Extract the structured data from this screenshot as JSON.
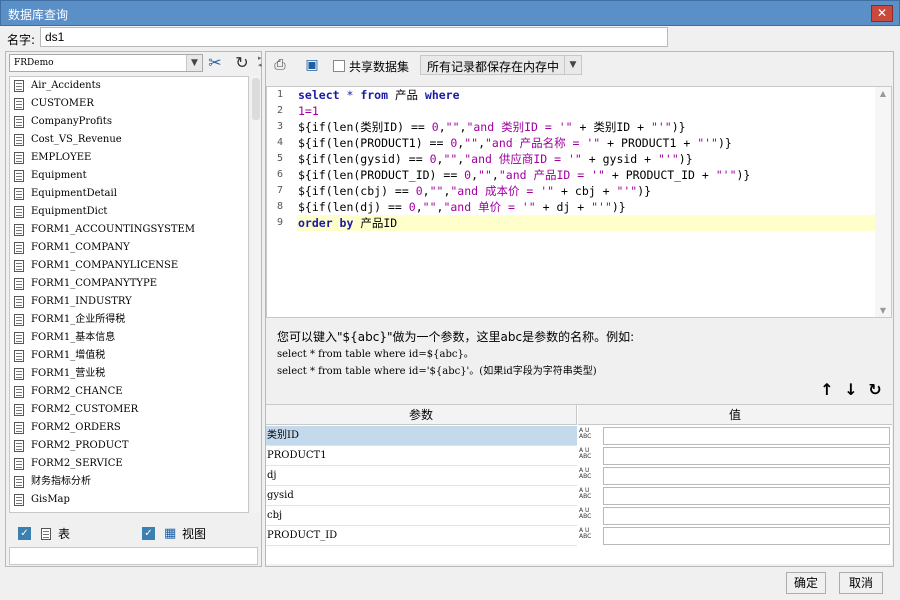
{
  "window": {
    "title": "数据库查询",
    "close_glyph": "✕"
  },
  "name_field": {
    "label": "名字:",
    "value": "ds1"
  },
  "datasource": {
    "selected": "FRDemo",
    "dropdown_glyph": "▼"
  },
  "tables": [
    "Air_Accidents",
    "CUSTOMER",
    "CompanyProfits",
    "Cost_VS_Revenue",
    "EMPLOYEE",
    "Equipment",
    "EquipmentDetail",
    "EquipmentDict",
    "FORM1_ACCOUNTINGSYSTEM",
    "FORM1_COMPANY",
    "FORM1_COMPANYLICENSE",
    "FORM1_COMPANYTYPE",
    "FORM1_INDUSTRY",
    "FORM1_企业所得税",
    "FORM1_基本信息",
    "FORM1_增值税",
    "FORM1_营业税",
    "FORM2_CHANCE",
    "FORM2_CUSTOMER",
    "FORM2_ORDERS",
    "FORM2_PRODUCT",
    "FORM2_SERVICE",
    "财务指标分析",
    "GisMap"
  ],
  "filters": {
    "table_label": "表",
    "view_label": "视图",
    "table_checked": true,
    "view_checked": true
  },
  "toolbar": {
    "share_label": "共享数据集",
    "memory_option": "所有记录都保存在内存中"
  },
  "sql_lines": [
    [
      {
        "t": "select",
        "c": "kw"
      },
      {
        "t": " * ",
        "c": "op"
      },
      {
        "t": "from",
        "c": "kw"
      },
      {
        "t": " 产品 ",
        "c": ""
      },
      {
        "t": "where",
        "c": "kw"
      }
    ],
    [
      {
        "t": "1=1",
        "c": "num"
      }
    ],
    [
      {
        "t": "${if(len(类别ID) == ",
        "c": ""
      },
      {
        "t": "0",
        "c": "num"
      },
      {
        "t": ",",
        "c": ""
      },
      {
        "t": "\"\"",
        "c": "str"
      },
      {
        "t": ",",
        "c": ""
      },
      {
        "t": "\"and 类别ID = '\"",
        "c": "str"
      },
      {
        "t": " + 类别ID + ",
        "c": ""
      },
      {
        "t": "\"'\"",
        "c": "str"
      },
      {
        "t": ")}",
        "c": ""
      }
    ],
    [
      {
        "t": "${if(len(PRODUCT1) == ",
        "c": ""
      },
      {
        "t": "0",
        "c": "num"
      },
      {
        "t": ",",
        "c": ""
      },
      {
        "t": "\"\"",
        "c": "str"
      },
      {
        "t": ",",
        "c": ""
      },
      {
        "t": "\"and 产品名称 = '\"",
        "c": "str"
      },
      {
        "t": " + PRODUCT1 + ",
        "c": ""
      },
      {
        "t": "\"'\"",
        "c": "str"
      },
      {
        "t": ")}",
        "c": ""
      }
    ],
    [
      {
        "t": "${if(len(gysid) == ",
        "c": ""
      },
      {
        "t": "0",
        "c": "num"
      },
      {
        "t": ",",
        "c": ""
      },
      {
        "t": "\"\"",
        "c": "str"
      },
      {
        "t": ",",
        "c": ""
      },
      {
        "t": "\"and 供应商ID = '\"",
        "c": "str"
      },
      {
        "t": " + gysid + ",
        "c": ""
      },
      {
        "t": "\"'\"",
        "c": "str"
      },
      {
        "t": ")}",
        "c": ""
      }
    ],
    [
      {
        "t": "${if(len(PRODUCT_ID) == ",
        "c": ""
      },
      {
        "t": "0",
        "c": "num"
      },
      {
        "t": ",",
        "c": ""
      },
      {
        "t": "\"\"",
        "c": "str"
      },
      {
        "t": ",",
        "c": ""
      },
      {
        "t": "\"and 产品ID = '\"",
        "c": "str"
      },
      {
        "t": " + PRODUCT_ID + ",
        "c": ""
      },
      {
        "t": "\"'\"",
        "c": "str"
      },
      {
        "t": ")}",
        "c": ""
      }
    ],
    [
      {
        "t": "${if(len(cbj) == ",
        "c": ""
      },
      {
        "t": "0",
        "c": "num"
      },
      {
        "t": ",",
        "c": ""
      },
      {
        "t": "\"\"",
        "c": "str"
      },
      {
        "t": ",",
        "c": ""
      },
      {
        "t": "\"and 成本价 = '\"",
        "c": "str"
      },
      {
        "t": " + cbj + ",
        "c": ""
      },
      {
        "t": "\"'\"",
        "c": "str"
      },
      {
        "t": ")}",
        "c": ""
      }
    ],
    [
      {
        "t": "${if(len(dj) == ",
        "c": ""
      },
      {
        "t": "0",
        "c": "num"
      },
      {
        "t": ",",
        "c": ""
      },
      {
        "t": "\"\"",
        "c": "str"
      },
      {
        "t": ",",
        "c": ""
      },
      {
        "t": "\"and 单价 = '\"",
        "c": "str"
      },
      {
        "t": " + dj + ",
        "c": ""
      },
      {
        "t": "\"'\"",
        "c": "str"
      },
      {
        "t": ")}",
        "c": ""
      }
    ],
    [
      {
        "t": "order by",
        "c": "kw"
      },
      {
        "t": " 产品ID",
        "c": ""
      }
    ]
  ],
  "hint": {
    "line1": "您可以键入\"${abc}\"做为一个参数，这里abc是参数的名称。例如:",
    "line2": "select * from table where id=${abc}。",
    "line3": "select * from table where id='${abc}'。(如果id字段为字符串类型)"
  },
  "params": {
    "header_name": "参数",
    "header_value": "值",
    "type_glyph": "A U\nABC",
    "rows": [
      {
        "name": "类别ID",
        "value": ""
      },
      {
        "name": "PRODUCT1",
        "value": ""
      },
      {
        "name": "dj",
        "value": ""
      },
      {
        "name": "gysid",
        "value": ""
      },
      {
        "name": "cbj",
        "value": ""
      },
      {
        "name": "PRODUCT_ID",
        "value": ""
      }
    ]
  },
  "icons": {
    "up": "↑",
    "down": "↓",
    "refresh": "↻",
    "tools": "✂",
    "reload": "↻"
  },
  "buttons": {
    "ok": "确定",
    "cancel": "取消"
  },
  "colors": {
    "titlebar": "#5a8fc7",
    "highlight_line": "#ffffcc",
    "selected_row": "#c5d9ec",
    "keyword": "#1a1aa6",
    "string": "#a000a0"
  }
}
